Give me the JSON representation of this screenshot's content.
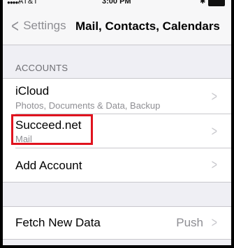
{
  "status": {
    "carrier": "AT&T",
    "time": "3:00 PM"
  },
  "nav": {
    "back_label": "Settings",
    "title": "Mail, Contacts, Calendars"
  },
  "accounts": {
    "header": "ACCOUNTS",
    "items": [
      {
        "title": "iCloud",
        "subtitle": "Photos, Documents & Data, Backup"
      },
      {
        "title": "Succeed.net",
        "subtitle": "Mail"
      },
      {
        "title": "Add Account"
      }
    ]
  },
  "fetch": {
    "label": "Fetch New Data",
    "value": "Push"
  },
  "colors": {
    "background": "#efeff4",
    "highlight": "#e0131e",
    "secondary_text": "#8e8e93"
  }
}
